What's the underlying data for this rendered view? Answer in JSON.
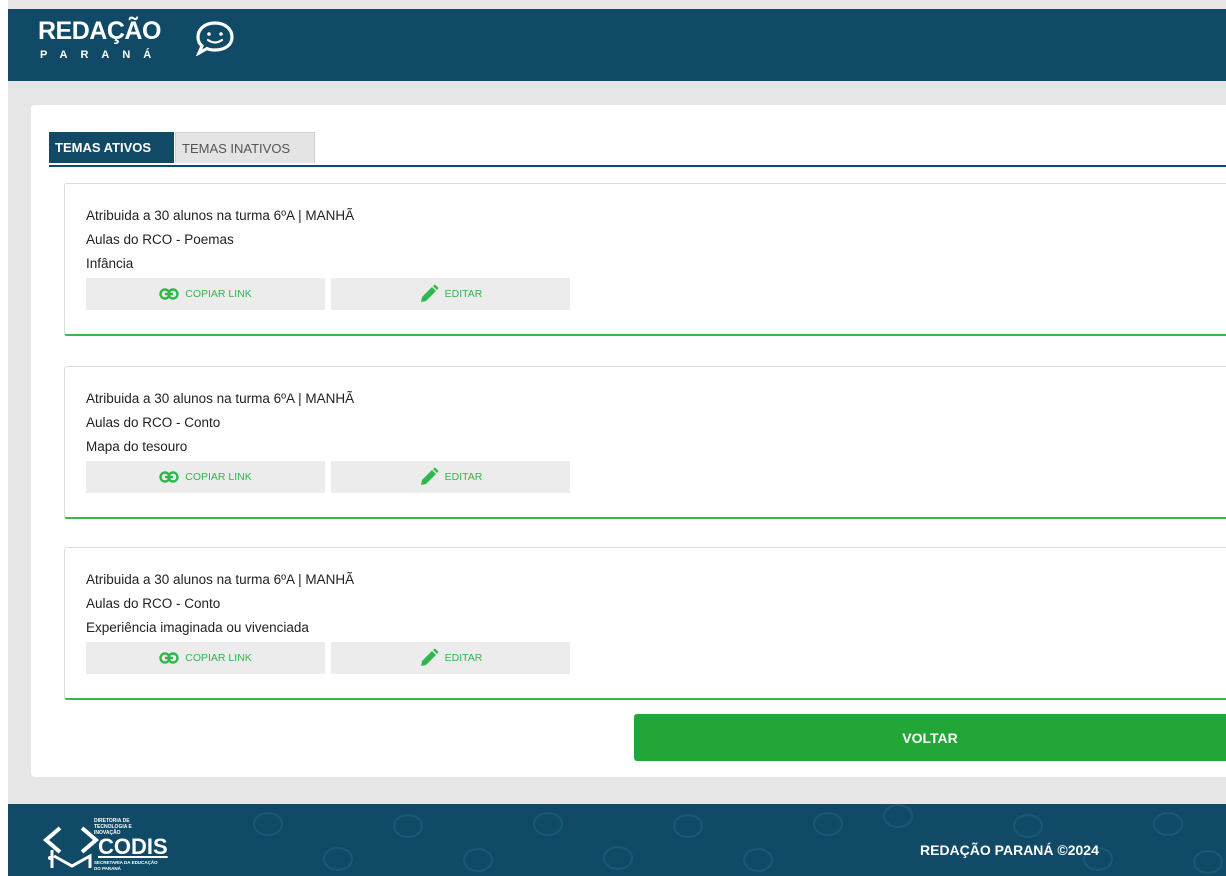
{
  "brand": {
    "logo_text": "REDAÇÃO",
    "logo_sub": "PARANÁ"
  },
  "tabs": [
    {
      "label": "TEMAS ATIVOS",
      "active": true
    },
    {
      "label": "TEMAS INATIVOS",
      "active": false
    }
  ],
  "cards": [
    {
      "assignment": "Atribuida a 30 alunos na turma 6ºA | MANHÃ",
      "course": "Aulas do RCO - Poemas",
      "theme": "Infância",
      "copy_label": "COPIAR LINK",
      "edit_label": "EDITAR"
    },
    {
      "assignment": "Atribuida a 30 alunos na turma 6ºA | MANHÃ",
      "course": "Aulas do RCO - Conto",
      "theme": "Mapa do tesouro",
      "copy_label": "COPIAR LINK",
      "edit_label": "EDITAR"
    },
    {
      "assignment": "Atribuida a 30 alunos na turma 6ºA | MANHÃ",
      "course": "Aulas do RCO - Conto",
      "theme": "Experiência imaginada ou vivenciada",
      "copy_label": "COPIAR LINK",
      "edit_label": "EDITAR"
    }
  ],
  "back_button": "VOLTAR",
  "footer": {
    "codis_top": "DIRETORIA DE TECNOLOGIA E INOVAÇÃO",
    "codis_name": "CODIS",
    "codis_bottom": "SECRETARIA DA EDUCAÇÃO DO PARANÁ",
    "copyright": "REDAÇÃO PARANÁ ©2024"
  },
  "colors": {
    "primary": "#114a66",
    "accent_green": "#22a637",
    "link_green": "#2db84b"
  },
  "icons": [
    "chat-bubble-icon",
    "link-icon",
    "pencil-icon",
    "codis-logo-icon"
  ]
}
